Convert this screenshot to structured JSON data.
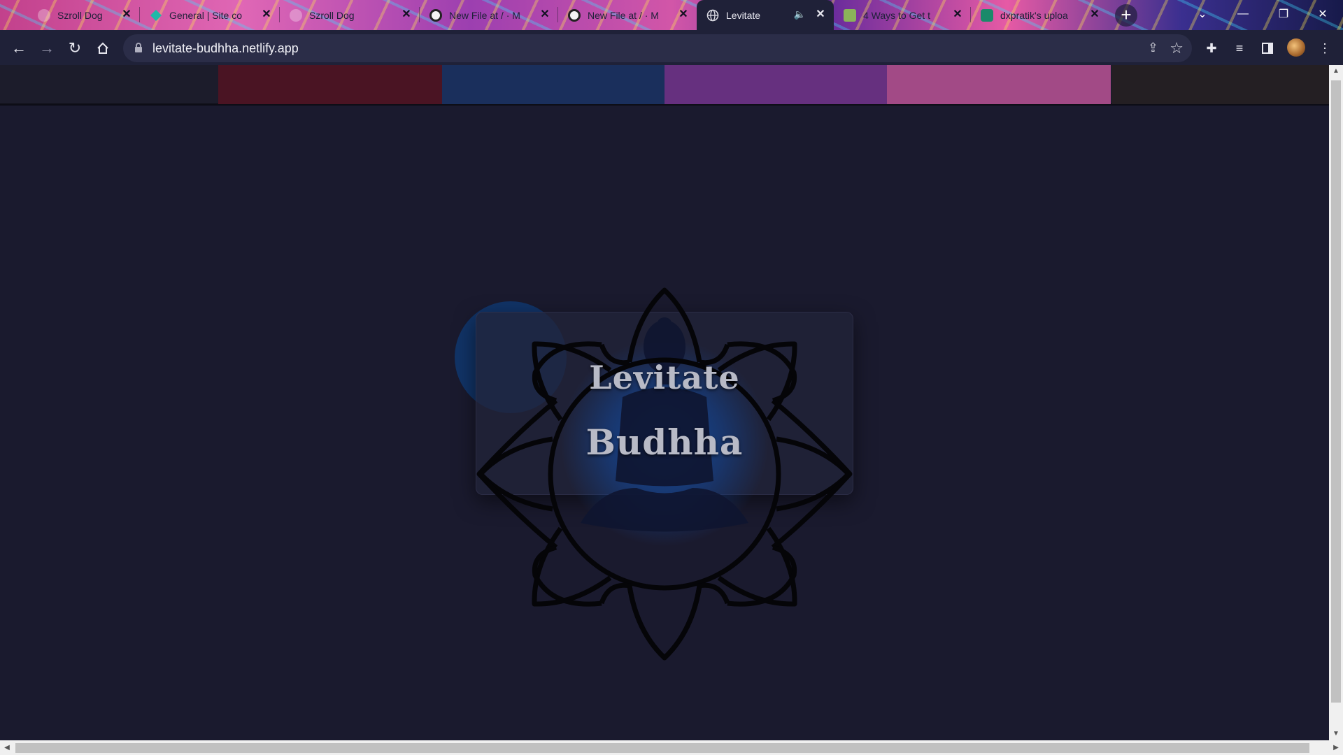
{
  "browser": {
    "tabs": [
      {
        "title": "Szroll Dog",
        "favicon": "szroll-icon",
        "active": false
      },
      {
        "title": "General | Site co",
        "favicon": "netlify-icon",
        "active": false
      },
      {
        "title": "Szroll Dog",
        "favicon": "szroll-icon",
        "active": false
      },
      {
        "title": "New File at / · M",
        "favicon": "github-icon",
        "active": false
      },
      {
        "title": "New File at / · M",
        "favicon": "github-icon",
        "active": false
      },
      {
        "title": "Levitate",
        "favicon": "globe-icon",
        "active": true,
        "audio": true
      },
      {
        "title": "4 Ways to Get t",
        "favicon": "wikihow-icon",
        "active": false
      },
      {
        "title": "dxpratik's uploa",
        "favicon": "chat-icon",
        "active": false
      }
    ],
    "new_tab_label": "+",
    "url": "levitate-budhha.netlify.app"
  },
  "page": {
    "brand_line_1": "Levitate",
    "brand_line_2": "Budhha",
    "nav_colors": [
      "#4a1423",
      "#1a2f5c",
      "#66307f",
      "#a24a86"
    ],
    "nav_right_color": "#241f23",
    "accent": "#113366",
    "background": "#1a1a2e"
  }
}
